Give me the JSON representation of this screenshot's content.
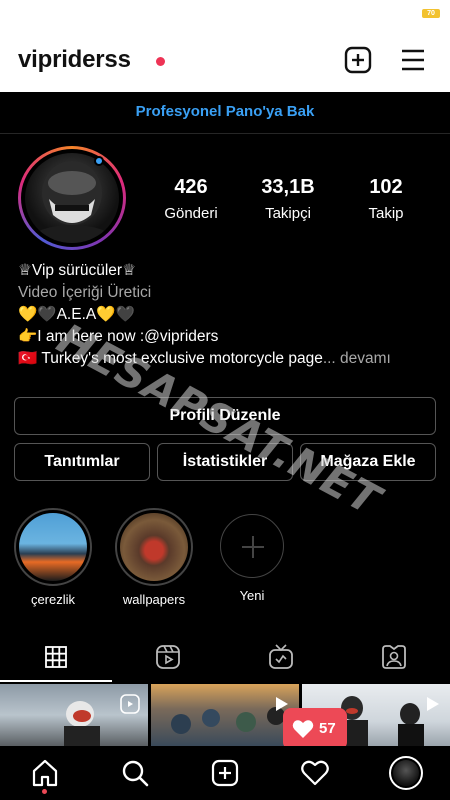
{
  "status": {
    "battery": "70"
  },
  "header": {
    "username": "vipriderss"
  },
  "dashboard": {
    "label": "Profesyonel Pano'ya Bak"
  },
  "stats": {
    "posts": {
      "value": "426",
      "label": "Gönderi"
    },
    "followers": {
      "value": "33,1B",
      "label": "Takipçi"
    },
    "following": {
      "value": "102",
      "label": "Takip"
    }
  },
  "bio": {
    "name": "♕Vip sürücüler♕",
    "category": "Video İçeriği Üretici",
    "line1": "💛🖤A.E.A💛🖤",
    "line2": "👉I am here now :@vipriders",
    "line3": "🇹🇷 Turkey's most exclusive motorcycle page",
    "more": "... devamı"
  },
  "buttons": {
    "edit_profile": "Profili Düzenle",
    "promotions": "Tanıtımlar",
    "insights": "İstatistikler",
    "add_shop": "Mağaza Ekle"
  },
  "highlights": [
    {
      "label": "çerezlik"
    },
    {
      "label": "wallpapers"
    },
    {
      "label": "Yeni"
    }
  ],
  "watermark": "HESAPSAT.NET",
  "notifications": {
    "likes": "57"
  },
  "colors": {
    "accent": "#3aa0f4",
    "like": "#ed4956"
  }
}
